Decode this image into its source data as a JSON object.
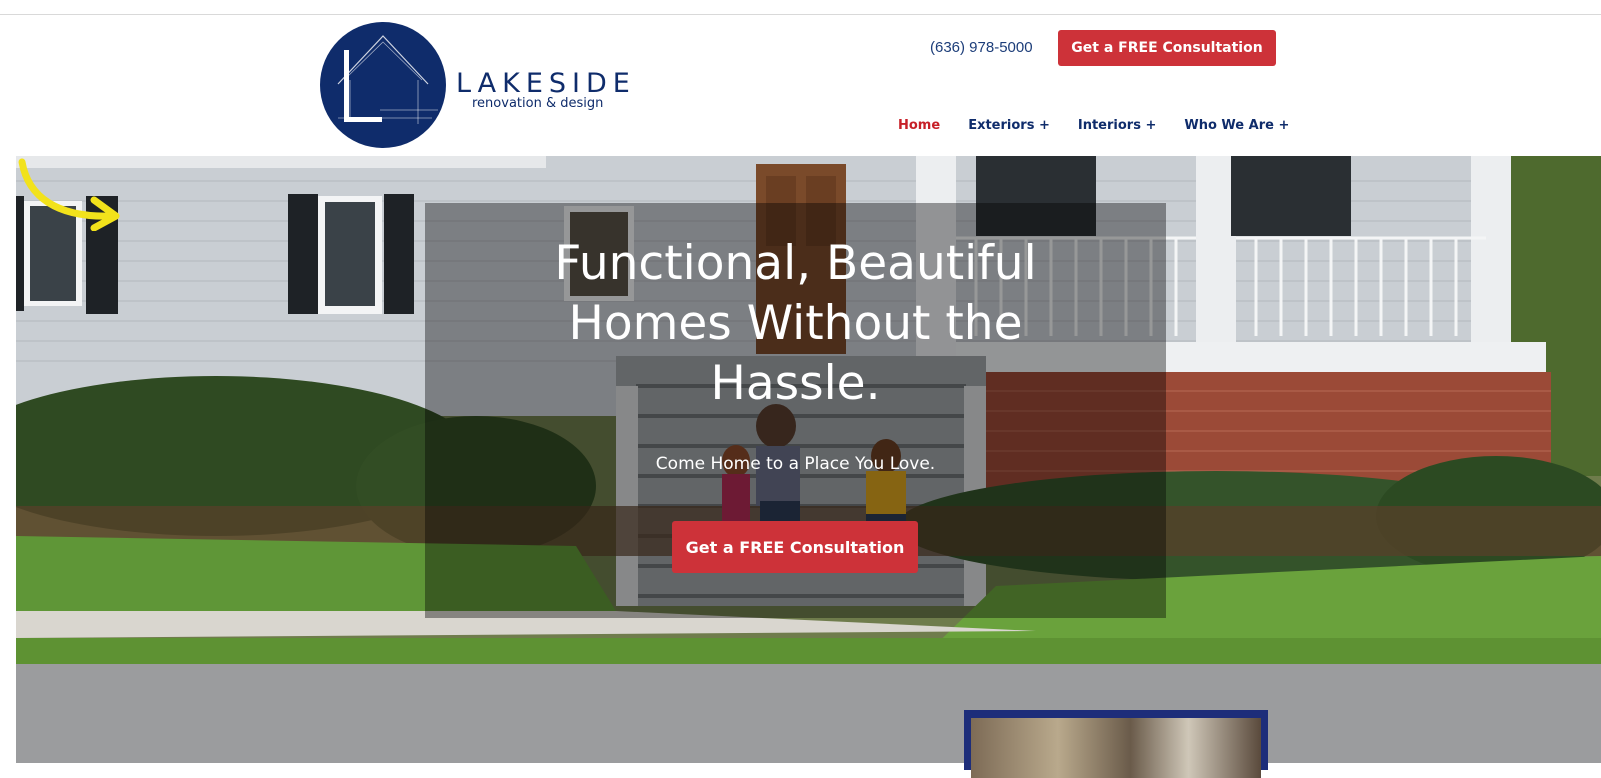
{
  "brand": {
    "name": "LAKESIDE",
    "tagline": "renovation & design",
    "logo_color": "#0f2c6b"
  },
  "header": {
    "phone": "(636) 978-5000",
    "cta_label": "Get a FREE Consultation"
  },
  "nav": {
    "items": [
      {
        "label": "Home",
        "active": true
      },
      {
        "label": "Exteriors +",
        "active": false
      },
      {
        "label": "Interiors +",
        "active": false
      },
      {
        "label": "Who We Are +",
        "active": false
      }
    ]
  },
  "hero": {
    "title_lines": [
      "Functional, Beautiful",
      "Homes Without the",
      "Hassle."
    ],
    "subtitle": "Come Home to a Place You Love.",
    "cta_label": "Get a FREE Consultation",
    "arrow_icon": "curved-arrow-icon"
  },
  "colors": {
    "accent_red": "#cd3239",
    "navy": "#0f2c6b",
    "arrow_yellow": "#f2e21b"
  }
}
